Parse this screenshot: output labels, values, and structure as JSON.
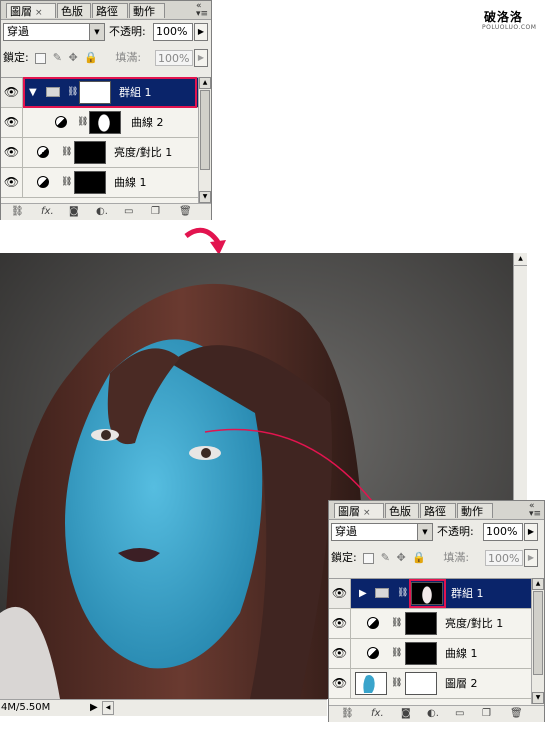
{
  "watermark": {
    "title": "破洛洛",
    "subtitle": "POLUOLUO.COM"
  },
  "panel_top": {
    "tabs": [
      {
        "label": "圖層",
        "close": "×"
      },
      {
        "label": "色版"
      },
      {
        "label": "路徑"
      },
      {
        "label": "動作"
      }
    ],
    "blend_mode": "穿過",
    "opacity_label": "不透明:",
    "opacity_value": "100%",
    "lock_label": "鎖定:",
    "fill_label": "填滿:",
    "fill_value": "100%",
    "layers": [
      {
        "name": "群組 1",
        "type": "group",
        "selected": true
      },
      {
        "name": "曲線 2",
        "type": "adjustment"
      },
      {
        "name": "亮度/對比 1",
        "type": "adjustment"
      },
      {
        "name": "曲線 1",
        "type": "adjustment"
      }
    ]
  },
  "panel_bottom": {
    "tabs": [
      {
        "label": "圖層",
        "close": "×"
      },
      {
        "label": "色版"
      },
      {
        "label": "路徑"
      },
      {
        "label": "動作"
      }
    ],
    "blend_mode": "穿過",
    "opacity_label": "不透明:",
    "opacity_value": "100%",
    "lock_label": "鎖定:",
    "fill_label": "填滿:",
    "fill_value": "100%",
    "layers": [
      {
        "name": "群組 1",
        "type": "group",
        "selected": true
      },
      {
        "name": "亮度/對比 1",
        "type": "adjustment"
      },
      {
        "name": "曲線 1",
        "type": "adjustment"
      },
      {
        "name": "圖層 2",
        "type": "pixel"
      }
    ]
  },
  "footer_icons": [
    "link-icon",
    "fx-icon",
    "mask-icon",
    "adjustment-icon",
    "folder-icon",
    "new-layer-icon",
    "trash-icon"
  ],
  "status_bar": {
    "doc_size": "4M/5.50M"
  },
  "colors": {
    "accent_red": "#e2144f",
    "selected_row": "#0a246a",
    "skin_blue": "#3aa4cb"
  }
}
